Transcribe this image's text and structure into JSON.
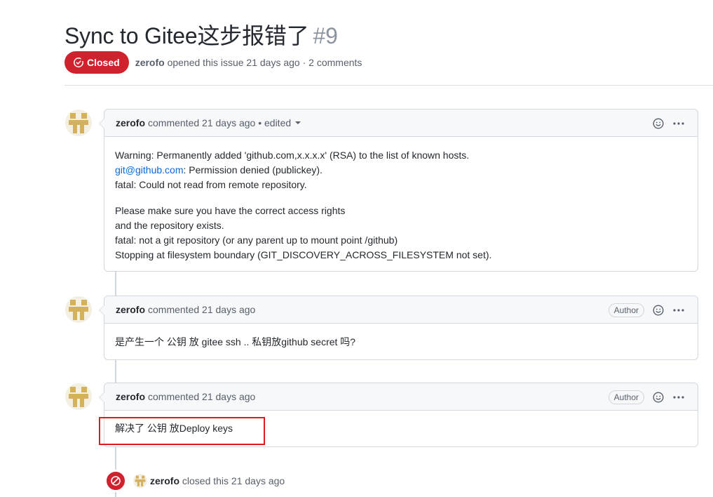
{
  "issue": {
    "title": "Sync to Gitee这步报错了",
    "number": "#9",
    "state_label": "Closed",
    "author": "zerofo",
    "meta_text": "opened this issue 21 days ago · 2 comments"
  },
  "comments": [
    {
      "author": "zerofo",
      "header_text": "commented 21 days ago • edited",
      "author_badge": "",
      "paragraphs": [
        {
          "lines": [
            "Warning: Permanently added 'github.com,x.x.x.x' (RSA) to the list of known hosts.",
            "Permission denied (publickey).",
            "fatal: Could not read from remote repository."
          ],
          "link_text": "git@github.com"
        },
        {
          "lines": [
            "Please make sure you have the correct access rights",
            "and the repository exists.",
            "fatal: not a git repository (or any parent up to mount point /github)",
            "Stopping at filesystem boundary (GIT_DISCOVERY_ACROSS_FILESYSTEM not set)."
          ]
        }
      ]
    },
    {
      "author": "zerofo",
      "header_text": "commented 21 days ago",
      "author_badge": "Author",
      "body": "是产生一个 公钥 放 gitee ssh .. 私钥放github secret 吗?"
    },
    {
      "author": "zerofo",
      "header_text": "commented 21 days ago",
      "author_badge": "Author",
      "body": "解决了 公钥 放Deploy keys"
    }
  ],
  "event": {
    "actor": "zerofo",
    "text": "closed this 21 days ago"
  },
  "colors": {
    "closed_red": "#cf222e",
    "link_blue": "#0969da",
    "highlight_red": "#e0191b",
    "avatar_gold": "#d4b15a"
  },
  "icons": {
    "state": "issue-closed-icon",
    "reaction": "smiley-icon",
    "more": "kebab-horizontal-icon",
    "event": "skip-icon"
  }
}
